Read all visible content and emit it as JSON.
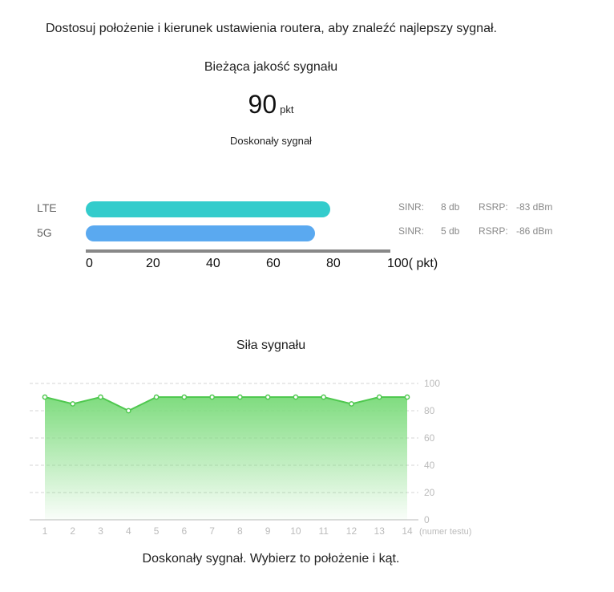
{
  "instruction": "Dostosuj położenie i kierunek ustawienia routera, aby znaleźć najlepszy sygnał.",
  "quality": {
    "title": "Bieżąca jakość sygnału",
    "score": "90",
    "unit": "pkt",
    "status": "Doskonały sygnał"
  },
  "bars": [
    {
      "label": "LTE",
      "value": 80,
      "color": "#33cccc",
      "sinr_label": "SINR:",
      "sinr_value": "8 db",
      "rsrp_label": "RSRP:",
      "rsrp_value": "-83 dBm"
    },
    {
      "label": "5G",
      "value": 75,
      "color": "#5aa9f0",
      "sinr_label": "SINR:",
      "sinr_value": "5 db",
      "rsrp_label": "RSRP:",
      "rsrp_value": "-86 dBm"
    }
  ],
  "bar_axis": {
    "ticks": [
      "0",
      "20",
      "40",
      "60",
      "80"
    ],
    "last_tick": "100( pkt)"
  },
  "chart_data": {
    "type": "area",
    "title": "Siła sygnału",
    "x": [
      1,
      2,
      3,
      4,
      5,
      6,
      7,
      8,
      9,
      10,
      11,
      12,
      13,
      14
    ],
    "xlabel": "(numer testu)",
    "ylim": [
      0,
      100
    ],
    "yticks": [
      0,
      20,
      40,
      60,
      80,
      100
    ],
    "series": [
      {
        "values": [
          90,
          85,
          90,
          80,
          90,
          90,
          90,
          90,
          90,
          90,
          90,
          85,
          90,
          90
        ]
      }
    ],
    "grid": true,
    "line_color": "#4fc84f",
    "fill_color": "#7fdc7f"
  },
  "footer": "Doskonały sygnał. Wybierz to położenie i kąt."
}
